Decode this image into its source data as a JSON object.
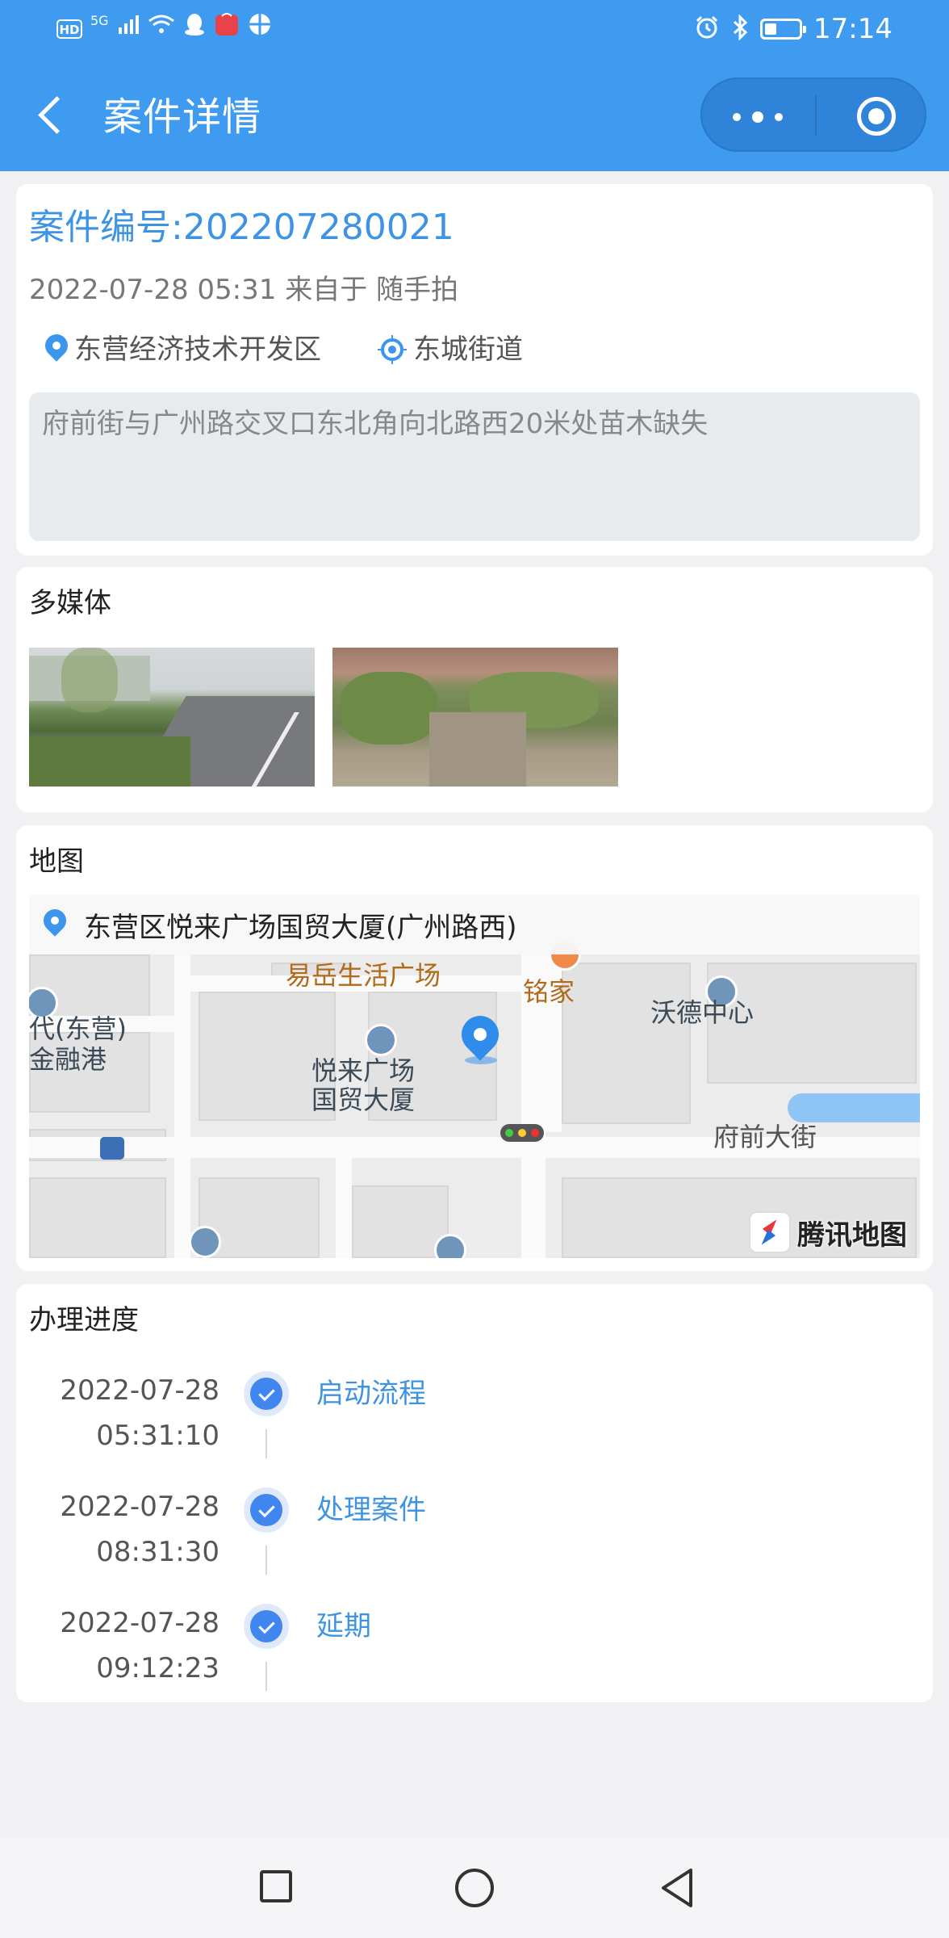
{
  "status_bar": {
    "time": "17:14",
    "signal": "5G",
    "hd": "HD",
    "battery_level": 0.35
  },
  "header": {
    "title": "案件详情",
    "back_icon": "chevron-left-icon",
    "more_icon": "more-dots-icon",
    "close_icon": "target-circle-icon",
    "colors": {
      "bar": "#3f9bf0",
      "capsule": "#2f84d9"
    }
  },
  "case": {
    "number": "案件编号:202207280021",
    "meta": "2022-07-28 05:31 来自于 随手拍",
    "district": "东营经济技术开发区",
    "street": "东城街道",
    "description": "府前街与广州路交叉口东北角向北路西20米处苗木缺失"
  },
  "media": {
    "title": "多媒体",
    "photos": [
      "photo-1",
      "photo-2"
    ]
  },
  "map": {
    "title": "地图",
    "address": "东营区悦来广场国贸大厦(广州路西)",
    "labels": {
      "poi_life": "易岳生活广场",
      "poi_ming": "铭家",
      "bld_wode": "沃德中心",
      "bld_left_1": "代(东营)",
      "bld_left_2": "金融港",
      "bld_yuelai_1": "悦来广场",
      "bld_yuelai_2": "国贸大厦",
      "road": "府前大街"
    },
    "logo": "腾讯地图"
  },
  "progress": {
    "title": "办理进度",
    "steps": [
      {
        "date": "2022-07-28",
        "time": "05:31:10",
        "label": "启动流程"
      },
      {
        "date": "2022-07-28",
        "time": "08:31:30",
        "label": "处理案件"
      },
      {
        "date": "2022-07-28",
        "time": "09:12:23",
        "label": "延期"
      }
    ]
  },
  "colors": {
    "accent": "#3e94e2",
    "check": "#3f86ee",
    "background": "#f1f1f3"
  }
}
